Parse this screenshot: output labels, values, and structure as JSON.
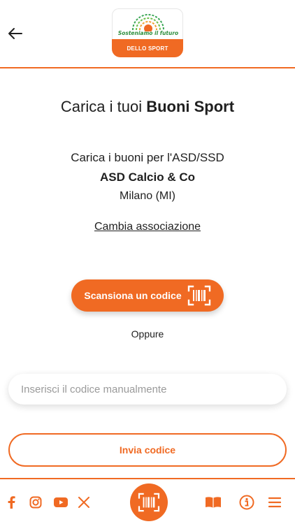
{
  "header": {
    "back_icon": "arrow-left-icon",
    "logo": {
      "tagline": "Sosteniamo il futuro",
      "subtitle": "DELLO SPORT"
    }
  },
  "main": {
    "title_prefix": "Carica i tuoi ",
    "title_bold": "Buoni Sport",
    "info_line1": "Carica i buoni per l'ASD/SSD",
    "association_name": "ASD Calcio & Co",
    "association_location": "Milano (MI)",
    "change_link": "Cambia associazione",
    "scan_button": "Scansiona un codice",
    "or_text": "Oppure",
    "manual_input_placeholder": "Inserisci il codice manualmente",
    "manual_input_value": "",
    "send_button": "Invia codice"
  },
  "footer": {
    "icons": [
      "facebook-icon",
      "instagram-icon",
      "youtube-icon",
      "x-icon",
      "barcode-scan-icon",
      "book-icon",
      "info-icon",
      "menu-icon"
    ]
  },
  "colors": {
    "accent": "#f06a23",
    "text": "#1f1f1f",
    "placeholder": "#9a9a9a",
    "logo_green": "#2f8f3e"
  }
}
